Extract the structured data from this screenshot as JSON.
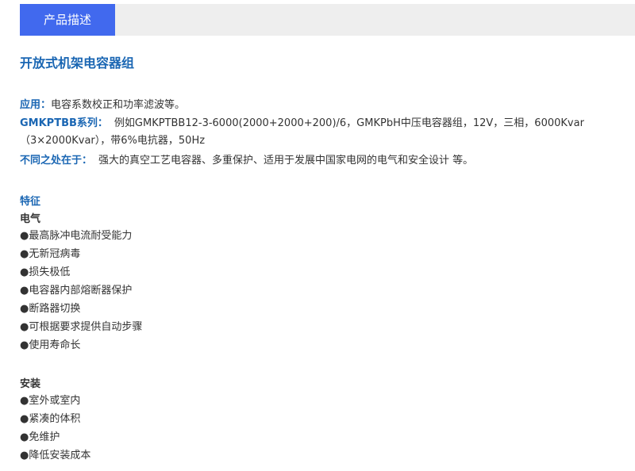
{
  "tabs": [
    {
      "label": "产品描述",
      "active": true
    }
  ],
  "colors": {
    "accent_blue": "#1a66b3",
    "tab_active_bg": "#4169ee",
    "tabbar_bg": "#eeeeee"
  },
  "product": {
    "title": "开放式机架电容器组",
    "application_label": "应用：",
    "application_text": "电容系数校正和功率滤波等。",
    "series_label": "GMKPTBB系列：",
    "series_text_line1": "例如GMKPTBB12-3-6000(2000+2000+200)/6，GMKPbH中压电容器组，12V，三相，6000Kvar",
    "series_text_line2": "（3×2000Kvar），带6%电抗器，50Hz",
    "difference_label": "不同之处在于：",
    "difference_text": "强大的真空工艺电容器、多重保护、适用于发展中国家电网的电气和安全设计 等。"
  },
  "features": {
    "heading": "特征",
    "electrical": {
      "heading": "电气",
      "items": [
        "●最高脉冲电流耐受能力",
        "●无新冠病毒",
        "●损失极低",
        "●电容器内部熔断器保护",
        "●断路器切换",
        "●可根据要求提供自动步骤",
        "●使用寿命长"
      ]
    },
    "installation": {
      "heading": "安装",
      "items": [
        "●室外或室内",
        "●紧凑的体积",
        "●免维护",
        "●降低安装成本"
      ]
    }
  }
}
